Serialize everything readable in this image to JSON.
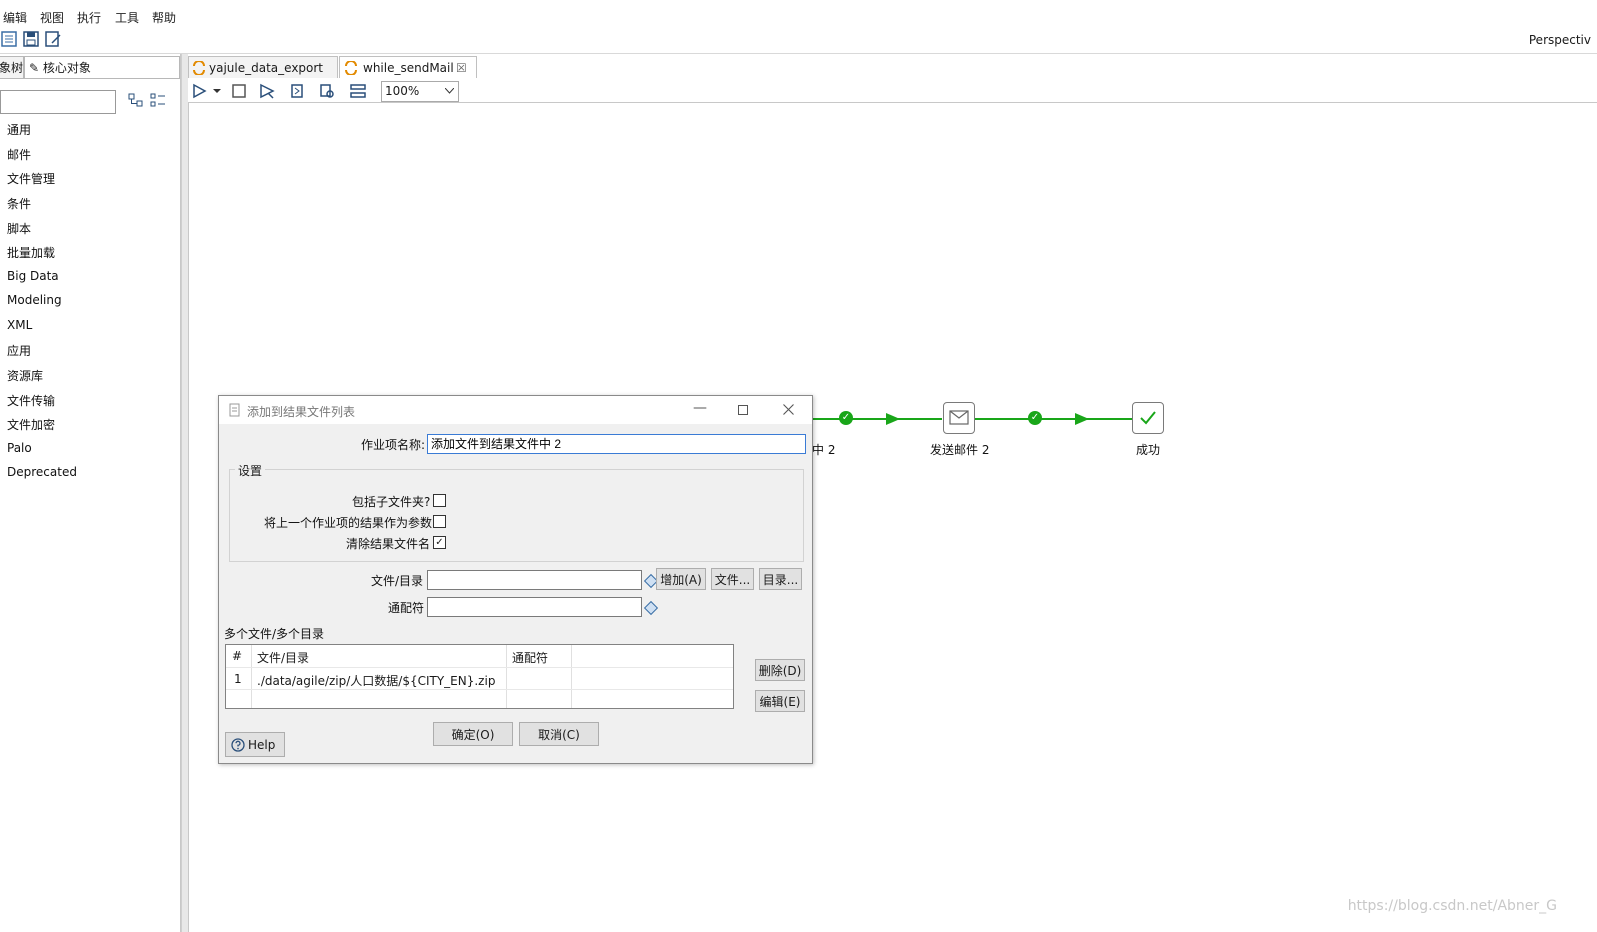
{
  "menu": [
    "编辑",
    "视图",
    "执行",
    "工具",
    "帮助"
  ],
  "perspective": "Perspectiv",
  "left_panel": {
    "tabs": [
      "象树",
      "核心对象"
    ],
    "search_value": "",
    "categories": [
      "通用",
      "邮件",
      "文件管理",
      "条件",
      "脚本",
      "批量加载",
      "Big Data",
      "Modeling",
      "XML",
      "应用",
      "资源库",
      "文件传输",
      "文件加密",
      "Palo",
      "Deprecated"
    ]
  },
  "editor": {
    "tabs": [
      "yajule_data_export",
      "while_sendMail"
    ],
    "close_glyph": "☒",
    "zoom": "100%"
  },
  "flow": {
    "nodes": [
      {
        "label": "中 2"
      },
      {
        "label": "发送邮件 2"
      },
      {
        "label": "成功"
      }
    ]
  },
  "dialog": {
    "title": "添加到结果文件列表",
    "name_label": "作业项名称:",
    "name_value": "添加文件到结果文件中 2",
    "group_title": "设置",
    "opt_include_subfolders": "包括子文件夹?",
    "opt_prev_results": "将上一个作业项的结果作为参数",
    "opt_clear_names": "清除结果文件名",
    "file_dir_label": "文件/目录",
    "wildcard_label": "通配符",
    "add_button": "增加(A)",
    "file_button": "文件...",
    "dir_button": "目录...",
    "multi_label": "多个文件/多个目录",
    "table": {
      "headers": [
        "#",
        "文件/目录",
        "通配符"
      ],
      "rows": [
        {
          "num": "1",
          "path": "./data/agile/zip/人口数据/${CITY_EN}.zip",
          "wildcard": ""
        }
      ]
    },
    "delete_button": "删除(D)",
    "edit_button": "编辑(E)",
    "ok_button": "确定(O)",
    "cancel_button": "取消(C)",
    "help_button": "Help"
  },
  "watermark": "https://blog.csdn.net/Abner_G",
  "colors": {
    "flow_green": "#19a619",
    "dialog_bg": "#f0f0f0"
  }
}
